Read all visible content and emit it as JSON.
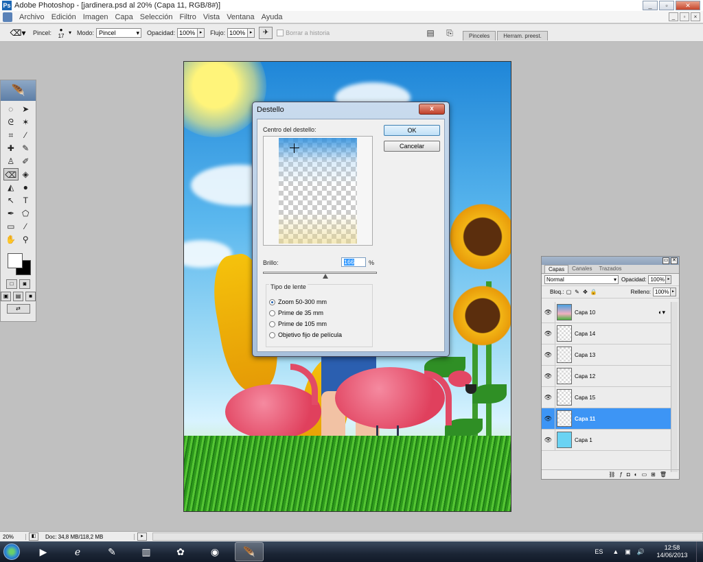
{
  "window": {
    "title": "Adobe Photoshop - [jardinera.psd al 20% (Capa 11, RGB/8#)]",
    "controls": [
      "_",
      "▫",
      "✕"
    ],
    "doc_controls": [
      "_",
      "▫",
      "×"
    ]
  },
  "menu": {
    "items": [
      "Archivo",
      "Edición",
      "Imagen",
      "Capa",
      "Selección",
      "Filtro",
      "Vista",
      "Ventana",
      "Ayuda"
    ]
  },
  "options": {
    "brush_label": "Pincel:",
    "brush_size": "17",
    "mode_label": "Modo:",
    "mode_value": "Pincel",
    "opacity_label": "Opacidad:",
    "opacity_value": "100%",
    "flow_label": "Flujo:",
    "flow_value": "100%",
    "erase_history_label": "Borrar a historia",
    "palette_tabs": [
      "Pinceles",
      "Herram. preest."
    ]
  },
  "dialog": {
    "title": "Destello",
    "close": "x",
    "center_label": "Centro del destello:",
    "ok": "OK",
    "cancel": "Cancelar",
    "brightness_label": "Brillo:",
    "brightness_value": "166",
    "brightness_unit": "%",
    "brightness_level": 0.55,
    "lens_group_label": "Tipo de lente",
    "lens_options": [
      "Zoom 50-300 mm",
      "Prime de 35 mm",
      "Prime de 105 mm",
      "Objetivo fijo de película"
    ],
    "lens_selected": 0
  },
  "layers_panel": {
    "tabs": [
      "Capas",
      "Canales",
      "Trazados"
    ],
    "blend_mode": "Normal",
    "opacity_label": "Opacidad:",
    "opacity_value": "100%",
    "lock_label": "Bloq.:",
    "fill_label": "Relleno:",
    "fill_value": "100%",
    "layers": [
      {
        "name": "Capa 10",
        "thumb": "pic",
        "selected": false
      },
      {
        "name": "Capa 14",
        "thumb": "transparent",
        "selected": false
      },
      {
        "name": "Capa 13",
        "thumb": "transparent",
        "selected": false
      },
      {
        "name": "Capa 12",
        "thumb": "transparent",
        "selected": false
      },
      {
        "name": "Capa 15",
        "thumb": "transparent",
        "selected": false
      },
      {
        "name": "Capa 11",
        "thumb": "transparent",
        "selected": true
      },
      {
        "name": "Capa 1",
        "thumb": "cyan",
        "selected": false
      }
    ]
  },
  "status": {
    "zoom": "20%",
    "doc": "Doc: 34,8 MB/118,2 MB"
  },
  "taskbar": {
    "lang": "ES",
    "time": "12:58",
    "date": "14/06/2013"
  }
}
